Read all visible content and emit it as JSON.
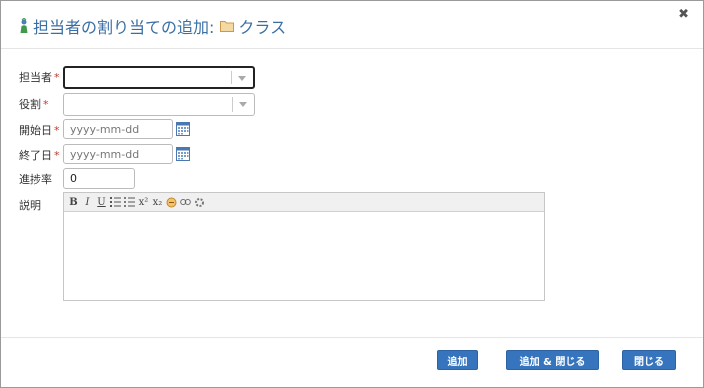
{
  "dialog": {
    "title": "担当者の割り当ての追加:",
    "title_tail": "クラス",
    "close_symbol": "✖"
  },
  "form": {
    "assignee": {
      "label": "担当者",
      "required_mark": "*",
      "value": ""
    },
    "role": {
      "label": "役割",
      "required_mark": "*",
      "value": ""
    },
    "start_date": {
      "label": "開始日",
      "required_mark": "*",
      "value": "",
      "placeholder": "yyyy-mm-dd"
    },
    "end_date": {
      "label": "終了日",
      "required_mark": "*",
      "value": "",
      "placeholder": "yyyy-mm-dd"
    },
    "progress": {
      "label": "進捗率",
      "value": "0"
    },
    "description": {
      "label": "説明",
      "toolbar": [
        "B",
        "I",
        "U",
        "ordered-list",
        "unordered-list",
        "x²",
        "x₂",
        "insert-link",
        "unlink",
        "hr"
      ]
    }
  },
  "footer": {
    "add_label": "追加",
    "add_close_label": "追加 & 閉じる",
    "close_label": "閉じる"
  },
  "colors": {
    "title": "#3a6fa5",
    "button": "#3675bd",
    "required": "#c0392b"
  },
  "icons": {
    "title_icon": "assignee-add-icon",
    "folder": "folder-icon",
    "calendar": "calendar-icon"
  }
}
